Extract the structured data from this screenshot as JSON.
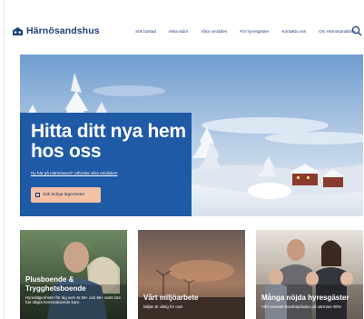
{
  "header": {
    "logo_text": "Härnösandshus",
    "logo_icon": "house-logo-icon",
    "nav": [
      {
        "label": "Sök bostad"
      },
      {
        "label": "Mina sidor"
      },
      {
        "label": "Våra områden"
      },
      {
        "label": "För hyresgäster"
      },
      {
        "label": "Kontakta oss"
      },
      {
        "label": "Om Härnösandshus"
      }
    ],
    "search_icon": "search-icon"
  },
  "hero": {
    "title": "Hitta ditt nya hem hos oss",
    "link": "Ny här på Härnösand? Utforska våra områden!",
    "button_label": "Sök lediga lägenheter",
    "panel_color": "#1f5aa6",
    "button_color": "#f4c0a6"
  },
  "cards": [
    {
      "title": "Plusboende & Trygghetsboende",
      "subtitle": "Hyreslägenheter för dig som är 55+ och 65+ samt inte har några hemmaboende barn."
    },
    {
      "title": "Vårt miljöarbete",
      "subtitle": "Miljön är viktig för oss!"
    },
    {
      "title": "Många nöjda hyresgäster",
      "subtitle": "Vårt senaste kundnöjdindex på närmare 90%"
    }
  ]
}
